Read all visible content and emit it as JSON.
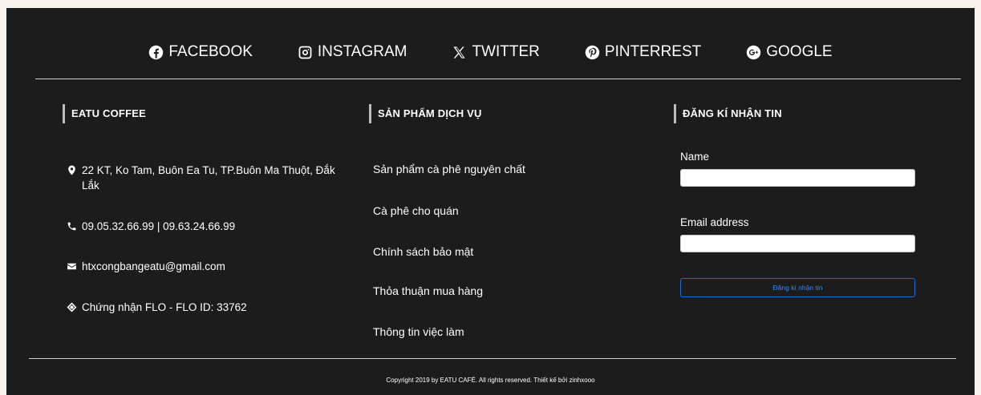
{
  "social": [
    {
      "icon": "facebook-icon",
      "label": "FACEBOOK"
    },
    {
      "icon": "instagram-icon",
      "label": "INSTAGRAM"
    },
    {
      "icon": "x-twitter-icon",
      "label": "TWITTER"
    },
    {
      "icon": "pinterest-icon",
      "label": "PINTERREST"
    },
    {
      "icon": "google-icon",
      "label": "GOOGLE"
    }
  ],
  "about": {
    "title": "EATU COFFEE",
    "address": "22 KT, Ko Tam, Buôn Ea Tu, TP.Buôn Ma Thuột, Đắk Lắk",
    "phone": "09.05.32.66.99 | 09.63.24.66.99",
    "email": "htxcongbangeatu@gmail.com",
    "certificate": "Chứng nhận FLO - FLO ID: 33762"
  },
  "services": {
    "title": "SẢN PHẨM DỊCH VỤ",
    "items": [
      "Sản phẩm cà phê nguyên chất",
      "Cà phê cho quán",
      "Chính sách bảo mật",
      "Thỏa thuận mua hàng",
      "Thông tin việc làm"
    ]
  },
  "newsletter": {
    "title": "ĐĂNG KÍ NHẬN TIN",
    "name_label": "Name",
    "email_label": "Email address",
    "submit_label": "Đăng kí nhận tin"
  },
  "copyright": "Copyright 2019 by EATU CAFÉ. All rights reserved. Thiết kế bởi zinhxooo",
  "colors": {
    "background": "#1c1c1c",
    "accent": "#1e6bd6",
    "text": "#ffffff"
  }
}
